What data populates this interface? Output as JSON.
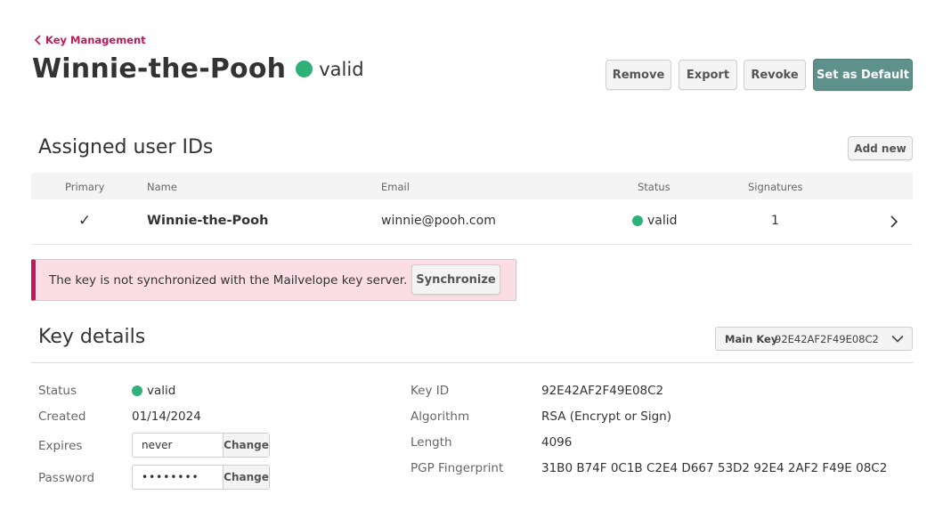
{
  "breadcrumb": {
    "label": "Key Management"
  },
  "header": {
    "title": "Winnie-the-Pooh",
    "status": "valid"
  },
  "actions": {
    "remove": "Remove",
    "export": "Export",
    "revoke": "Revoke",
    "set_default": "Set as Default"
  },
  "user_ids": {
    "title": "Assigned user IDs",
    "add_new": "Add new",
    "columns": {
      "primary": "Primary",
      "name": "Name",
      "email": "Email",
      "status": "Status",
      "signatures": "Signatures"
    },
    "rows": [
      {
        "primary": "✓",
        "name": "Winnie-the-Pooh",
        "email": "winnie@pooh.com",
        "status": "valid",
        "signatures": "1"
      }
    ]
  },
  "alert": {
    "text": "The key is not synchronized with the Mailvelope key server.",
    "button": "Synchronize"
  },
  "key_details": {
    "title": "Key details",
    "selector": {
      "type": "Main Key",
      "id": "92E42AF2F49E08C2"
    },
    "left": {
      "status_label": "Status",
      "status_value": "valid",
      "created_label": "Created",
      "created_value": "01/14/2024",
      "expires_label": "Expires",
      "expires_value": "never",
      "password_label": "Password",
      "password_value": "••••••••",
      "change": "Change"
    },
    "right": {
      "keyid_label": "Key ID",
      "keyid_value": "92E42AF2F49E08C2",
      "algorithm_label": "Algorithm",
      "algorithm_value": "RSA (Encrypt or Sign)",
      "length_label": "Length",
      "length_value": "4096",
      "fingerprint_label": "PGP Fingerprint",
      "fingerprint_value": "31B0 B74F 0C1B C2E4 D667 53D2 92E4 2AF2 F49E 08C2"
    }
  },
  "colors": {
    "accent": "#c0185a",
    "valid": "#2fb27a",
    "primary_button": "#5f918c",
    "alert_bg": "#fbdde5"
  }
}
